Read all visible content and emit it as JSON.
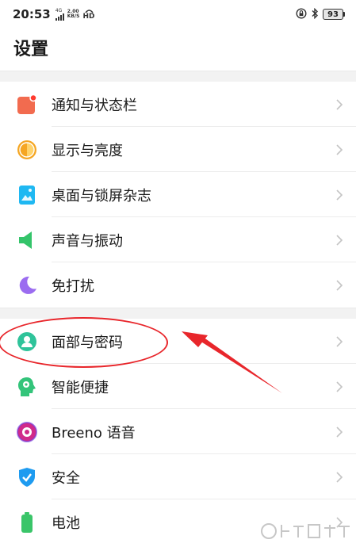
{
  "status_bar": {
    "time": "20:53",
    "signal_top": "4G",
    "net_speed_value": "2.00",
    "net_speed_unit": "KB/S",
    "hd": "HD",
    "battery": "93"
  },
  "page": {
    "title": "设置"
  },
  "groups": [
    {
      "items": [
        {
          "label": "通知与状态栏",
          "icon": "notification-icon",
          "color": "#f26b4f"
        },
        {
          "label": "显示与亮度",
          "icon": "brightness-icon",
          "color": "#f5a623"
        },
        {
          "label": "桌面与锁屏杂志",
          "icon": "wallpaper-icon",
          "color": "#1fb8f2"
        },
        {
          "label": "声音与振动",
          "icon": "speaker-icon",
          "color": "#34c46a"
        },
        {
          "label": "免打扰",
          "icon": "moon-icon",
          "color": "#9b6cf0"
        }
      ]
    },
    {
      "items": [
        {
          "label": "面部与密码",
          "icon": "face-lock-icon",
          "color": "#2fc39a"
        },
        {
          "label": "智能便捷",
          "icon": "smart-head-icon",
          "color": "#33c47a"
        },
        {
          "label": "Breeno 语音",
          "icon": "breeno-icon",
          "color": "#d02a8a"
        },
        {
          "label": "安全",
          "icon": "shield-icon",
          "color": "#1e9bf0"
        },
        {
          "label": "电池",
          "icon": "battery-icon",
          "color": "#3ac569"
        }
      ]
    }
  ],
  "colors": {
    "annotation": "#e8262b"
  }
}
